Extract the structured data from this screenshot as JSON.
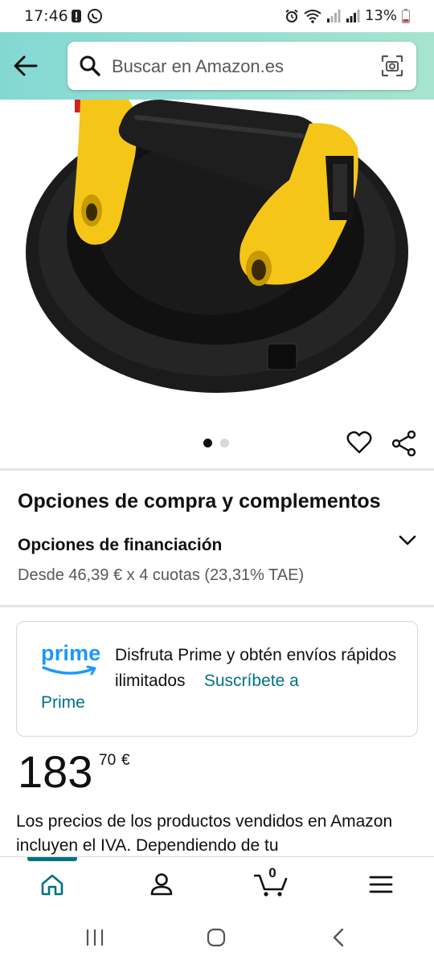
{
  "status_bar": {
    "time": "17:46",
    "battery": "13%",
    "icons": [
      "alert-icon",
      "whatsapp-icon",
      "alarm-icon",
      "wifi-icon",
      "signal-icon",
      "signal-icon",
      "battery-icon"
    ]
  },
  "search": {
    "placeholder": "Buscar en Amazon.es"
  },
  "gallery": {
    "image_description_icon": "vacuum-suction-cup-lifter",
    "dots": [
      true,
      false
    ]
  },
  "purchase_options": {
    "title": "Opciones de compra y complementos"
  },
  "financing": {
    "title": "Opciones de financiación",
    "detail": "Desde 46,39 € x 4 cuotas (23,31% TAE)"
  },
  "prime": {
    "logo_text": "prime",
    "text": "Disfruta Prime y obtén envíos rápidos ilimitados",
    "link_part1": "Suscríbete a",
    "link_part2": "Prime"
  },
  "price": {
    "whole": "183",
    "fraction": "70",
    "currency": "€"
  },
  "vat_note": "Los precios de los productos vendidos en Amazon incluyen el IVA. Dependiendo de tu",
  "bottom_nav": {
    "items": [
      "home-icon",
      "account-icon",
      "cart-icon",
      "menu-icon"
    ],
    "cart_count": "0",
    "active": "home"
  },
  "colors": {
    "header_gradient_start": "#84d8d4",
    "header_gradient_end": "#a6e4cf",
    "link": "#007185",
    "prime_blue": "#1a98ff",
    "product_yellow": "#f5c518"
  }
}
